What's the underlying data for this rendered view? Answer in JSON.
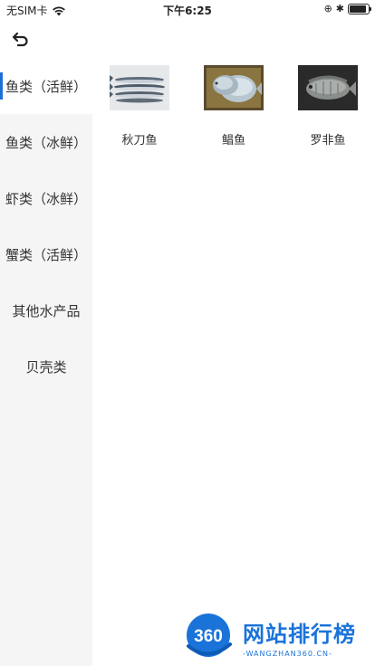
{
  "status_bar": {
    "carrier": "无SIM卡",
    "time": "下午6:25",
    "battery_level": 0.9
  },
  "nav": {
    "back_icon": "back-arrow-icon"
  },
  "sidebar": {
    "items": [
      {
        "label": "鱼类（活鲜）",
        "active": true
      },
      {
        "label": "鱼类（冰鲜）",
        "active": false
      },
      {
        "label": "虾类（冰鲜）",
        "active": false
      },
      {
        "label": "蟹类（活鲜）",
        "active": false
      },
      {
        "label": "其他水产品",
        "active": false
      },
      {
        "label": "贝壳类",
        "active": false
      }
    ]
  },
  "products": [
    {
      "name": "秋刀鱼",
      "image": "saury-fish-image"
    },
    {
      "name": "鲳鱼",
      "image": "pomfret-fish-image"
    },
    {
      "name": "罗非鱼",
      "image": "tilapia-fish-image"
    }
  ],
  "watermark": {
    "logo_text": "360",
    "title": "网站排行榜",
    "subtitle": "-WANGZHAN360.CN-"
  },
  "colors": {
    "accent": "#1e6fd9",
    "sidebar_bg": "#f5f5f5",
    "watermark": "#1a73d9"
  }
}
